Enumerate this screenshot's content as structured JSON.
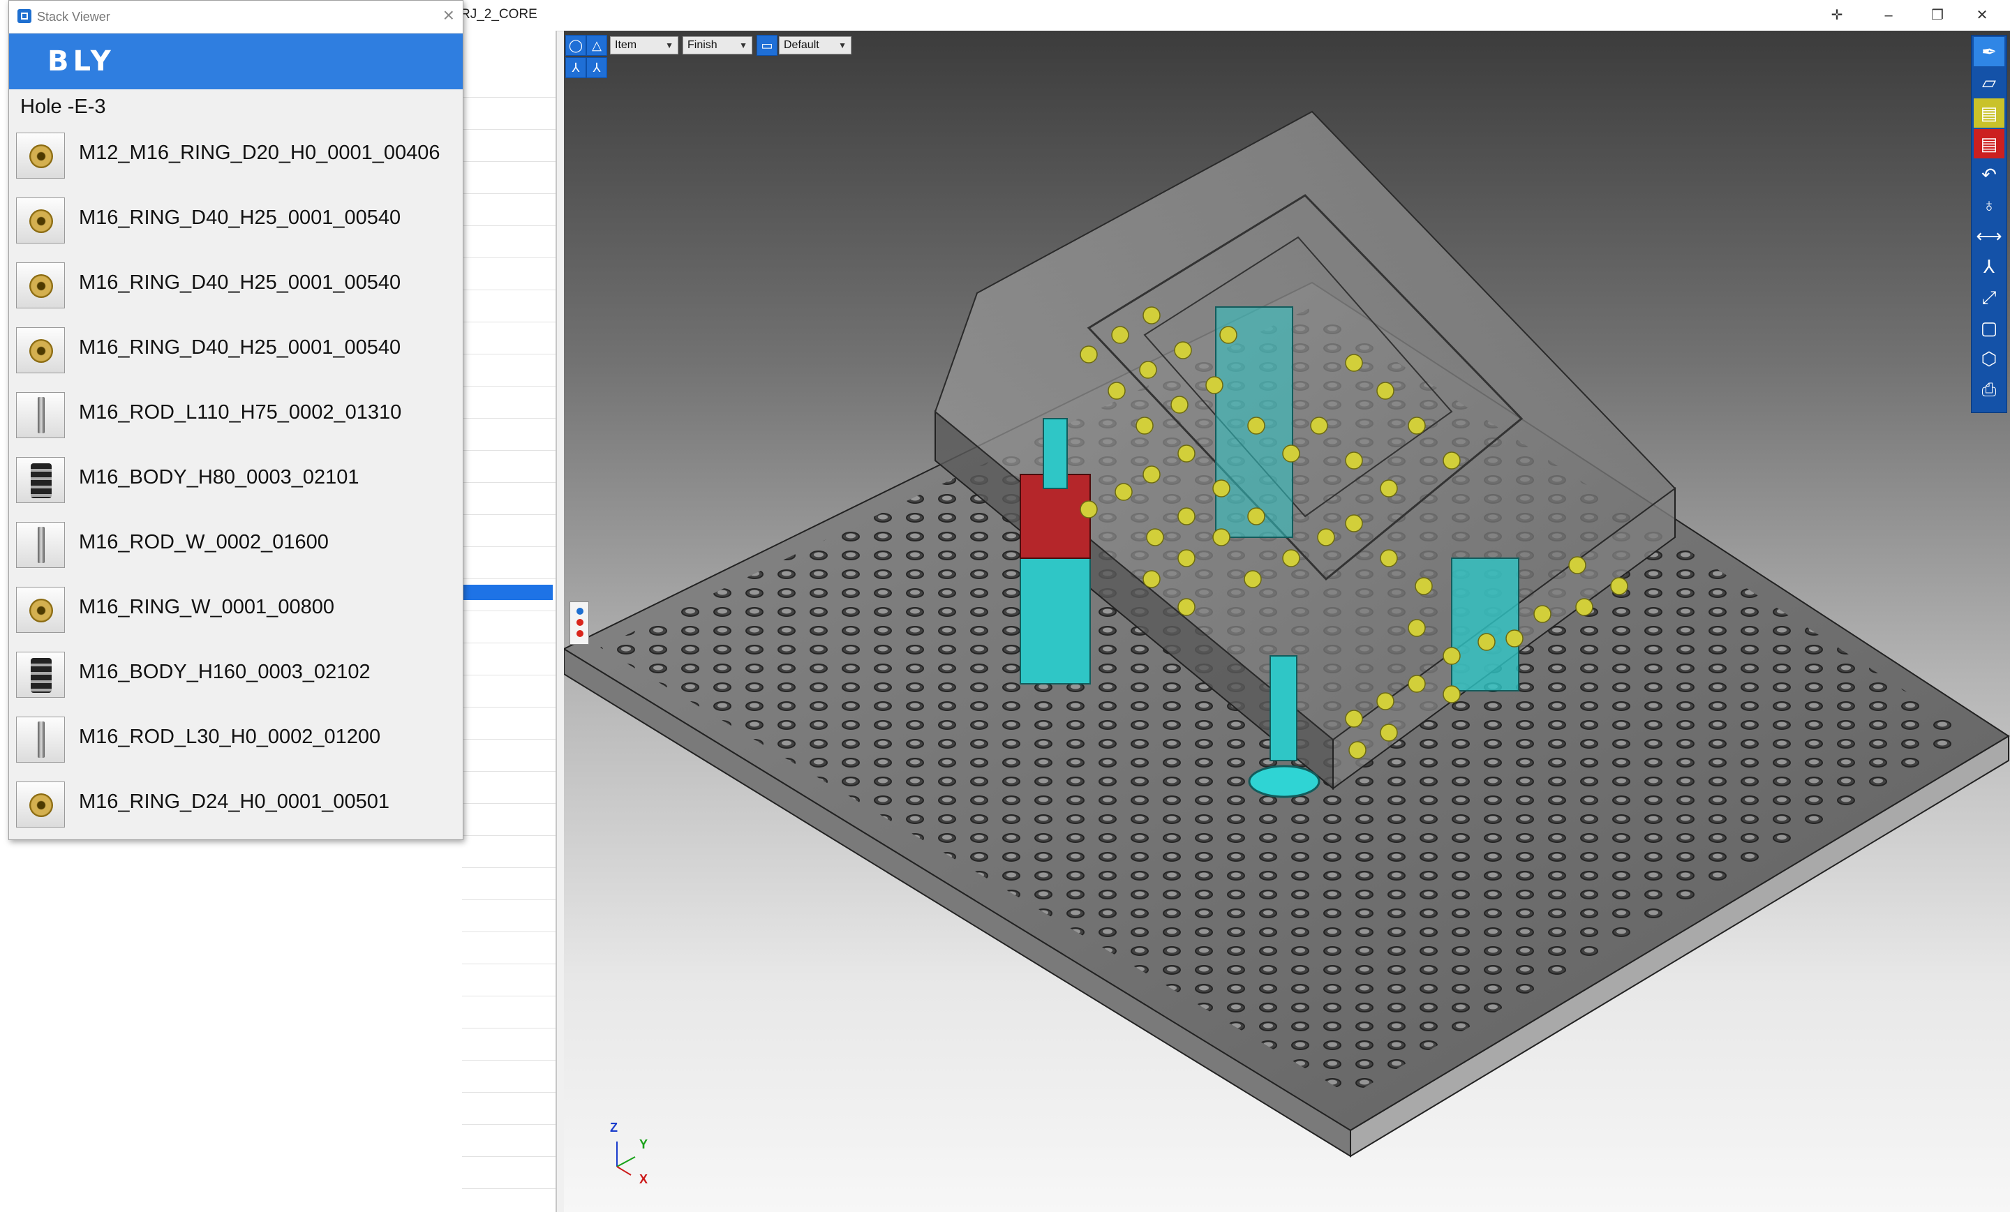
{
  "window": {
    "title": "RJ_2_CORE",
    "minimize": "–",
    "maximize": "❐",
    "close": "✕"
  },
  "stack_viewer": {
    "title": "Stack Viewer",
    "logo": "BLY",
    "hole": "Hole -E-3",
    "items": [
      {
        "label": "M12_M16_RING_D20_H0_0001_00406",
        "thumb": "ring-gold"
      },
      {
        "label": "M16_RING_D40_H25_0001_00540",
        "thumb": "ring-gold"
      },
      {
        "label": "M16_RING_D40_H25_0001_00540",
        "thumb": "ring-gold"
      },
      {
        "label": "M16_RING_D40_H25_0001_00540",
        "thumb": "ring-gold"
      },
      {
        "label": "M16_ROD_L110_H75_0002_01310",
        "thumb": "rod-silver"
      },
      {
        "label": "M16_BODY_H80_0003_02101",
        "thumb": "body-black"
      },
      {
        "label": "M16_ROD_W_0002_01600",
        "thumb": "rod-silver"
      },
      {
        "label": "M16_RING_W_0001_00800",
        "thumb": "ring-gold"
      },
      {
        "label": "M16_BODY_H160_0003_02102",
        "thumb": "body-black"
      },
      {
        "label": "M16_ROD_L30_H0_0002_01200",
        "thumb": "rod-silver"
      },
      {
        "label": "M16_RING_D24_H0_0001_00501",
        "thumb": "ring-gold"
      }
    ]
  },
  "view_toolbar": {
    "select_item": "Item",
    "select_finish": "Finish",
    "select_default": "Default"
  },
  "right_toolbar": {
    "icons": [
      "pin-icon",
      "folder-open-icon",
      "layer-yellow-icon",
      "layer-red-icon",
      "undo-icon",
      "bulb-icon",
      "measure-icon",
      "axis-icon",
      "fit-view-icon",
      "frame-icon",
      "cube-icon",
      "print-icon"
    ]
  },
  "axes": {
    "z": "Z",
    "y": "Y",
    "x": "X"
  },
  "colors": {
    "accent": "#2f7ee0",
    "selection": "#1e73e6",
    "toolbar": "#1452a8",
    "pin_yellow": "#d2cf3a",
    "cyan_part": "#2fc6c6",
    "red_part": "#b5262a"
  }
}
